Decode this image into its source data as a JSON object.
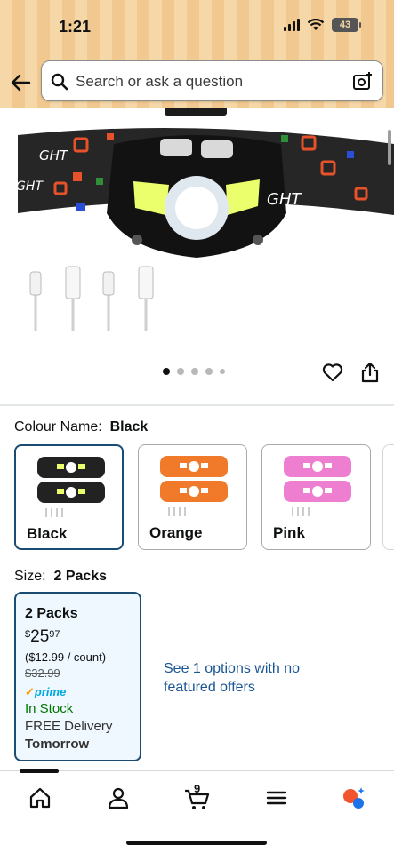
{
  "status_bar": {
    "time": "1:21",
    "battery": "43"
  },
  "search": {
    "placeholder": "Search or ask a question"
  },
  "product_image": {
    "carousel_dots": 5,
    "active_dot": 1,
    "headlamp_label": "GHT"
  },
  "colour": {
    "label": "Colour Name:",
    "selected": "Black",
    "options": [
      {
        "name": "Black",
        "color": "#222222",
        "selected": true
      },
      {
        "name": "Orange",
        "color": "#f07a2a",
        "selected": false
      },
      {
        "name": "Pink",
        "color": "#ee7fd0",
        "selected": false
      }
    ]
  },
  "size": {
    "label": "Size:",
    "selected": "2 Packs",
    "card": {
      "title": "2 Packs",
      "currency": "$",
      "price_whole": "25",
      "price_fraction": "97",
      "per_count": "($12.99 / count)",
      "list_price": "$32.99",
      "prime": "prime",
      "stock": "In Stock",
      "delivery": "FREE Delivery",
      "delivery_day": "Tomorrow"
    }
  },
  "other_options": "See 1 options with no featured offers",
  "bottom_nav": {
    "cart_count": "9",
    "items": [
      "home-icon",
      "account-icon",
      "cart-icon",
      "menu-icon",
      "rufus-icon"
    ]
  },
  "colors": {
    "header_bg": "#f6d7a8",
    "link": "#1a5594",
    "stock": "#007600",
    "selected_border": "#1a4b73",
    "prime": "#00a8e1"
  }
}
